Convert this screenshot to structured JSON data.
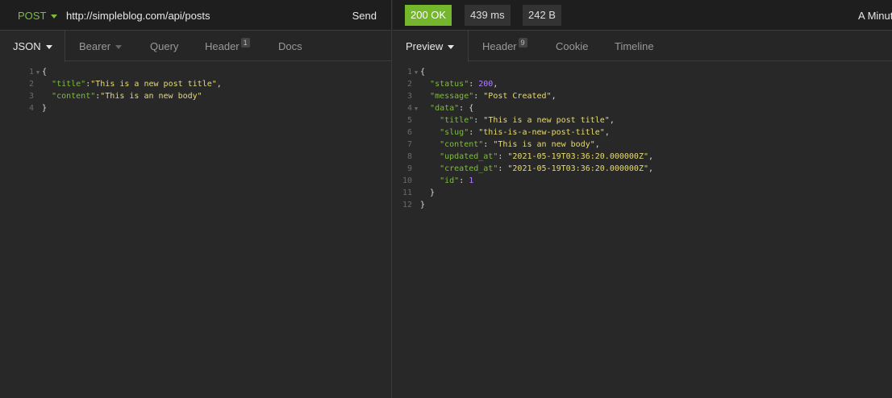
{
  "request": {
    "method": "POST",
    "url": "http://simpleblog.com/api/posts",
    "send_label": "Send",
    "tabs": [
      {
        "label": "JSON",
        "active": true
      },
      {
        "label": "Bearer"
      },
      {
        "label": "Query"
      },
      {
        "label": "Header",
        "count": "1"
      },
      {
        "label": "Docs"
      }
    ],
    "body_lines": [
      {
        "n": "1",
        "fold": true,
        "t": [
          [
            "p",
            "{"
          ]
        ]
      },
      {
        "n": "2",
        "t": [
          [
            "p",
            "  "
          ],
          [
            "k",
            "\"title\""
          ],
          [
            "p",
            ":"
          ],
          [
            "s",
            "\"This is a new post title\""
          ],
          [
            "p",
            ","
          ]
        ]
      },
      {
        "n": "3",
        "t": [
          [
            "p",
            "  "
          ],
          [
            "k",
            "\"content\""
          ],
          [
            "p",
            ":"
          ],
          [
            "s",
            "\"This is an new body\""
          ]
        ]
      },
      {
        "n": "4",
        "t": [
          [
            "p",
            "}"
          ]
        ]
      }
    ]
  },
  "response": {
    "status": "200 OK",
    "time": "439 ms",
    "size": "242 B",
    "age": "A Minute Ago",
    "status_color": "#75b72c",
    "tabs": [
      {
        "label": "Preview",
        "active": true
      },
      {
        "label": "Header",
        "count": "9"
      },
      {
        "label": "Cookie"
      },
      {
        "label": "Timeline"
      }
    ],
    "body_lines": [
      {
        "n": "1",
        "fold": true,
        "t": [
          [
            "p",
            "{"
          ]
        ]
      },
      {
        "n": "2",
        "t": [
          [
            "p",
            "  "
          ],
          [
            "k",
            "\"status\""
          ],
          [
            "p",
            ": "
          ],
          [
            "n",
            "200"
          ],
          [
            "p",
            ","
          ]
        ]
      },
      {
        "n": "3",
        "t": [
          [
            "p",
            "  "
          ],
          [
            "k",
            "\"message\""
          ],
          [
            "p",
            ": "
          ],
          [
            "s",
            "\"Post Created\""
          ],
          [
            "p",
            ","
          ]
        ]
      },
      {
        "n": "4",
        "fold": true,
        "t": [
          [
            "p",
            "  "
          ],
          [
            "k",
            "\"data\""
          ],
          [
            "p",
            ": {"
          ]
        ]
      },
      {
        "n": "5",
        "t": [
          [
            "p",
            "    "
          ],
          [
            "k",
            "\"title\""
          ],
          [
            "p",
            ": "
          ],
          [
            "s",
            "\"This is a new post title\""
          ],
          [
            "p",
            ","
          ]
        ]
      },
      {
        "n": "6",
        "t": [
          [
            "p",
            "    "
          ],
          [
            "k",
            "\"slug\""
          ],
          [
            "p",
            ": "
          ],
          [
            "s",
            "\"this-is-a-new-post-title\""
          ],
          [
            "p",
            ","
          ]
        ]
      },
      {
        "n": "7",
        "t": [
          [
            "p",
            "    "
          ],
          [
            "k",
            "\"content\""
          ],
          [
            "p",
            ": "
          ],
          [
            "s",
            "\"This is an new body\""
          ],
          [
            "p",
            ","
          ]
        ]
      },
      {
        "n": "8",
        "t": [
          [
            "p",
            "    "
          ],
          [
            "k",
            "\"updated_at\""
          ],
          [
            "p",
            ": "
          ],
          [
            "s",
            "\"2021-05-19T03:36:20.000000Z\""
          ],
          [
            "p",
            ","
          ]
        ]
      },
      {
        "n": "9",
        "t": [
          [
            "p",
            "    "
          ],
          [
            "k",
            "\"created_at\""
          ],
          [
            "p",
            ": "
          ],
          [
            "s",
            "\"2021-05-19T03:36:20.000000Z\""
          ],
          [
            "p",
            ","
          ]
        ]
      },
      {
        "n": "10",
        "t": [
          [
            "p",
            "    "
          ],
          [
            "k",
            "\"id\""
          ],
          [
            "p",
            ": "
          ],
          [
            "n",
            "1"
          ]
        ]
      },
      {
        "n": "11",
        "t": [
          [
            "p",
            "  }"
          ]
        ]
      },
      {
        "n": "12",
        "t": [
          [
            "p",
            "}"
          ]
        ]
      }
    ]
  }
}
